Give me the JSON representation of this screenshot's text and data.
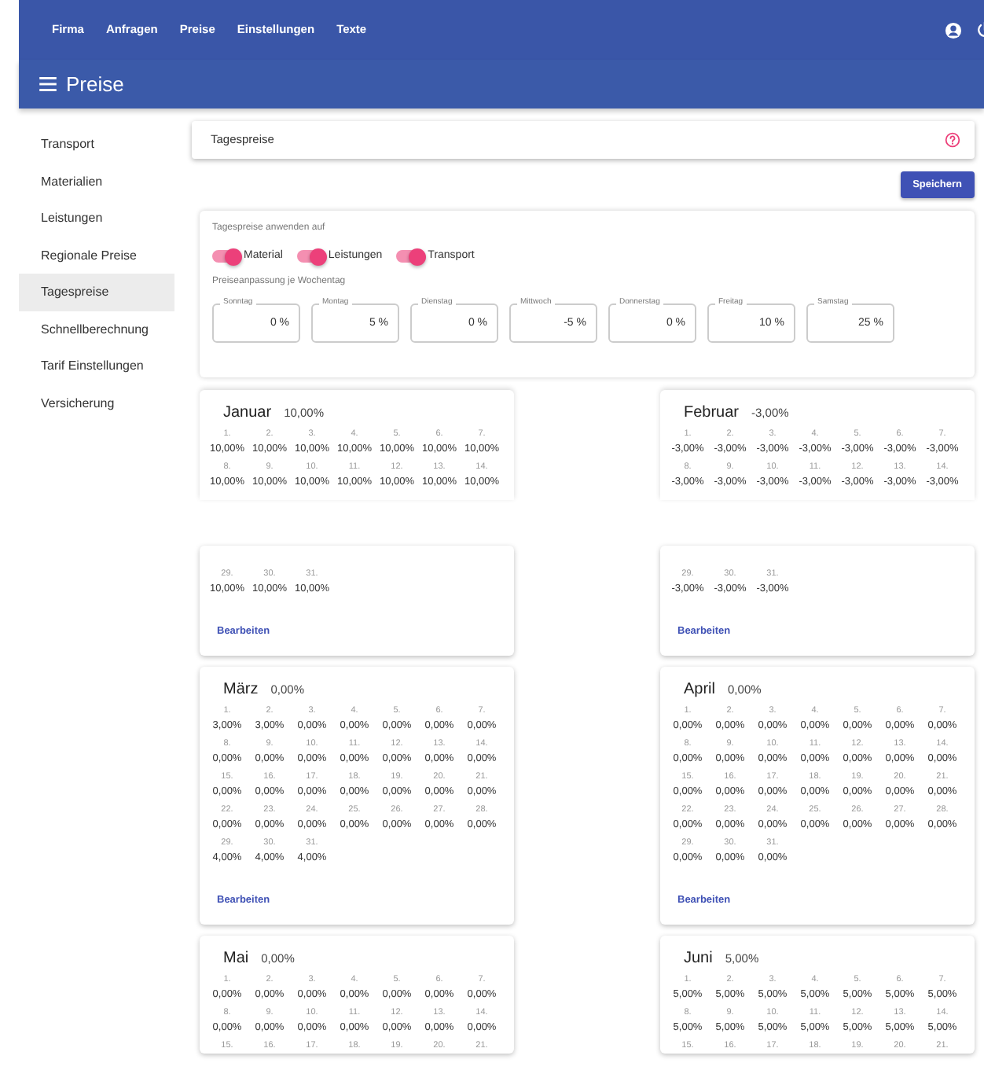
{
  "top_nav": {
    "items": [
      {
        "label": "Firma"
      },
      {
        "label": "Anfragen"
      },
      {
        "label": "Preise"
      },
      {
        "label": "Einstellungen"
      },
      {
        "label": "Texte"
      }
    ]
  },
  "title_bar": {
    "title": "Preise"
  },
  "sidebar": {
    "items": [
      {
        "label": "Transport",
        "selected": false
      },
      {
        "label": "Materialien",
        "selected": false
      },
      {
        "label": "Leistungen",
        "selected": false
      },
      {
        "label": "Regionale Preise",
        "selected": false
      },
      {
        "label": "Tagespreise",
        "selected": true
      },
      {
        "label": "Schnellberechnung",
        "selected": false
      },
      {
        "label": "Tarif Einstellungen",
        "selected": false
      },
      {
        "label": "Versicherung",
        "selected": false
      }
    ]
  },
  "section_header": {
    "title": "Tagespreise"
  },
  "save_button": "Speichern",
  "settings": {
    "apply_title": "Tagespreise anwenden auf",
    "toggles": [
      {
        "label": "Material",
        "on": true
      },
      {
        "label": "Leistungen",
        "on": true
      },
      {
        "label": "Transport",
        "on": true
      }
    ],
    "weekday_title": "Preiseanpassung je Wochentag",
    "weekdays": [
      {
        "label": "Sonntag",
        "value": "0 %"
      },
      {
        "label": "Montag",
        "value": "5 %"
      },
      {
        "label": "Dienstag",
        "value": "0 %"
      },
      {
        "label": "Mittwoch",
        "value": "-5 %"
      },
      {
        "label": "Donnerstag",
        "value": "0 %"
      },
      {
        "label": "Freitag",
        "value": "10 %"
      },
      {
        "label": "Samstag",
        "value": "25 %"
      }
    ]
  },
  "months": [
    {
      "name": "Januar",
      "total": "10,00%",
      "edit": "Bearbeiten",
      "fragments": [
        [
          {
            "day": "1.",
            "value": "10,00%"
          },
          {
            "day": "2.",
            "value": "10,00%"
          },
          {
            "day": "3.",
            "value": "10,00%"
          },
          {
            "day": "4.",
            "value": "10,00%"
          },
          {
            "day": "5.",
            "value": "10,00%"
          },
          {
            "day": "6.",
            "value": "10,00%"
          },
          {
            "day": "7.",
            "value": "10,00%"
          },
          {
            "day": "8.",
            "value": "10,00%"
          },
          {
            "day": "9.",
            "value": "10,00%"
          },
          {
            "day": "10.",
            "value": "10,00%"
          },
          {
            "day": "11.",
            "value": "10,00%"
          },
          {
            "day": "12.",
            "value": "10,00%"
          },
          {
            "day": "13.",
            "value": "10,00%"
          },
          {
            "day": "14.",
            "value": "10,00%"
          }
        ],
        [
          {
            "day": "29.",
            "value": "10,00%"
          },
          {
            "day": "30.",
            "value": "10,00%"
          },
          {
            "day": "31.",
            "value": "10,00%"
          }
        ]
      ]
    },
    {
      "name": "Februar",
      "total": "-3,00%",
      "edit": "Bearbeiten",
      "fragments": [
        [
          {
            "day": "1.",
            "value": "-3,00%"
          },
          {
            "day": "2.",
            "value": "-3,00%"
          },
          {
            "day": "3.",
            "value": "-3,00%"
          },
          {
            "day": "4.",
            "value": "-3,00%"
          },
          {
            "day": "5.",
            "value": "-3,00%"
          },
          {
            "day": "6.",
            "value": "-3,00%"
          },
          {
            "day": "7.",
            "value": "-3,00%"
          },
          {
            "day": "8.",
            "value": "-3,00%"
          },
          {
            "day": "9.",
            "value": "-3,00%"
          },
          {
            "day": "10.",
            "value": "-3,00%"
          },
          {
            "day": "11.",
            "value": "-3,00%"
          },
          {
            "day": "12.",
            "value": "-3,00%"
          },
          {
            "day": "13.",
            "value": "-3,00%"
          },
          {
            "day": "14.",
            "value": "-3,00%"
          }
        ],
        [
          {
            "day": "29.",
            "value": "-3,00%"
          },
          {
            "day": "30.",
            "value": "-3,00%"
          },
          {
            "day": "31.",
            "value": "-3,00%"
          }
        ]
      ]
    },
    {
      "name": "März",
      "total": "0,00%",
      "edit": "Bearbeiten",
      "fragments": [
        [
          {
            "day": "1.",
            "value": "3,00%"
          },
          {
            "day": "2.",
            "value": "3,00%"
          },
          {
            "day": "3.",
            "value": "0,00%"
          },
          {
            "day": "4.",
            "value": "0,00%"
          },
          {
            "day": "5.",
            "value": "0,00%"
          },
          {
            "day": "6.",
            "value": "0,00%"
          },
          {
            "day": "7.",
            "value": "0,00%"
          },
          {
            "day": "8.",
            "value": "0,00%"
          },
          {
            "day": "9.",
            "value": "0,00%"
          },
          {
            "day": "10.",
            "value": "0,00%"
          },
          {
            "day": "11.",
            "value": "0,00%"
          },
          {
            "day": "12.",
            "value": "0,00%"
          },
          {
            "day": "13.",
            "value": "0,00%"
          },
          {
            "day": "14.",
            "value": "0,00%"
          },
          {
            "day": "15.",
            "value": "0,00%"
          },
          {
            "day": "16.",
            "value": "0,00%"
          },
          {
            "day": "17.",
            "value": "0,00%"
          },
          {
            "day": "18.",
            "value": "0,00%"
          },
          {
            "day": "19.",
            "value": "0,00%"
          },
          {
            "day": "20.",
            "value": "0,00%"
          },
          {
            "day": "21.",
            "value": "0,00%"
          },
          {
            "day": "22.",
            "value": "0,00%"
          },
          {
            "day": "23.",
            "value": "0,00%"
          },
          {
            "day": "24.",
            "value": "0,00%"
          },
          {
            "day": "25.",
            "value": "0,00%"
          },
          {
            "day": "26.",
            "value": "0,00%"
          },
          {
            "day": "27.",
            "value": "0,00%"
          },
          {
            "day": "28.",
            "value": "0,00%"
          },
          {
            "day": "29.",
            "value": "4,00%"
          },
          {
            "day": "30.",
            "value": "4,00%"
          },
          {
            "day": "31.",
            "value": "4,00%"
          }
        ]
      ]
    },
    {
      "name": "April",
      "total": "0,00%",
      "edit": "Bearbeiten",
      "fragments": [
        [
          {
            "day": "1.",
            "value": "0,00%"
          },
          {
            "day": "2.",
            "value": "0,00%"
          },
          {
            "day": "3.",
            "value": "0,00%"
          },
          {
            "day": "4.",
            "value": "0,00%"
          },
          {
            "day": "5.",
            "value": "0,00%"
          },
          {
            "day": "6.",
            "value": "0,00%"
          },
          {
            "day": "7.",
            "value": "0,00%"
          },
          {
            "day": "8.",
            "value": "0,00%"
          },
          {
            "day": "9.",
            "value": "0,00%"
          },
          {
            "day": "10.",
            "value": "0,00%"
          },
          {
            "day": "11.",
            "value": "0,00%"
          },
          {
            "day": "12.",
            "value": "0,00%"
          },
          {
            "day": "13.",
            "value": "0,00%"
          },
          {
            "day": "14.",
            "value": "0,00%"
          },
          {
            "day": "15.",
            "value": "0,00%"
          },
          {
            "day": "16.",
            "value": "0,00%"
          },
          {
            "day": "17.",
            "value": "0,00%"
          },
          {
            "day": "18.",
            "value": "0,00%"
          },
          {
            "day": "19.",
            "value": "0,00%"
          },
          {
            "day": "20.",
            "value": "0,00%"
          },
          {
            "day": "21.",
            "value": "0,00%"
          },
          {
            "day": "22.",
            "value": "0,00%"
          },
          {
            "day": "23.",
            "value": "0,00%"
          },
          {
            "day": "24.",
            "value": "0,00%"
          },
          {
            "day": "25.",
            "value": "0,00%"
          },
          {
            "day": "26.",
            "value": "0,00%"
          },
          {
            "day": "27.",
            "value": "0,00%"
          },
          {
            "day": "28.",
            "value": "0,00%"
          },
          {
            "day": "29.",
            "value": "0,00%"
          },
          {
            "day": "30.",
            "value": "0,00%"
          },
          {
            "day": "31.",
            "value": "0,00%"
          }
        ]
      ]
    },
    {
      "name": "Mai",
      "total": "0,00%",
      "fragments": [
        [
          {
            "day": "1.",
            "value": "0,00%"
          },
          {
            "day": "2.",
            "value": "0,00%"
          },
          {
            "day": "3.",
            "value": "0,00%"
          },
          {
            "day": "4.",
            "value": "0,00%"
          },
          {
            "day": "5.",
            "value": "0,00%"
          },
          {
            "day": "6.",
            "value": "0,00%"
          },
          {
            "day": "7.",
            "value": "0,00%"
          },
          {
            "day": "8.",
            "value": "0,00%"
          },
          {
            "day": "9.",
            "value": "0,00%"
          },
          {
            "day": "10.",
            "value": "0,00%"
          },
          {
            "day": "11.",
            "value": "0,00%"
          },
          {
            "day": "12.",
            "value": "0,00%"
          },
          {
            "day": "13.",
            "value": "0,00%"
          },
          {
            "day": "14.",
            "value": "0,00%"
          },
          {
            "day": "15."
          },
          {
            "day": "16."
          },
          {
            "day": "17."
          },
          {
            "day": "18."
          },
          {
            "day": "19."
          },
          {
            "day": "20."
          },
          {
            "day": "21."
          }
        ]
      ]
    },
    {
      "name": "Juni",
      "total": "5,00%",
      "fragments": [
        [
          {
            "day": "1.",
            "value": "5,00%"
          },
          {
            "day": "2.",
            "value": "5,00%"
          },
          {
            "day": "3.",
            "value": "5,00%"
          },
          {
            "day": "4.",
            "value": "5,00%"
          },
          {
            "day": "5.",
            "value": "5,00%"
          },
          {
            "day": "6.",
            "value": "5,00%"
          },
          {
            "day": "7.",
            "value": "5,00%"
          },
          {
            "day": "8.",
            "value": "5,00%"
          },
          {
            "day": "9.",
            "value": "5,00%"
          },
          {
            "day": "10.",
            "value": "5,00%"
          },
          {
            "day": "11.",
            "value": "5,00%"
          },
          {
            "day": "12.",
            "value": "5,00%"
          },
          {
            "day": "13.",
            "value": "5,00%"
          },
          {
            "day": "14.",
            "value": "5,00%"
          },
          {
            "day": "15."
          },
          {
            "day": "16."
          },
          {
            "day": "17."
          },
          {
            "day": "18."
          },
          {
            "day": "19."
          },
          {
            "day": "20."
          },
          {
            "day": "21."
          }
        ]
      ]
    }
  ]
}
